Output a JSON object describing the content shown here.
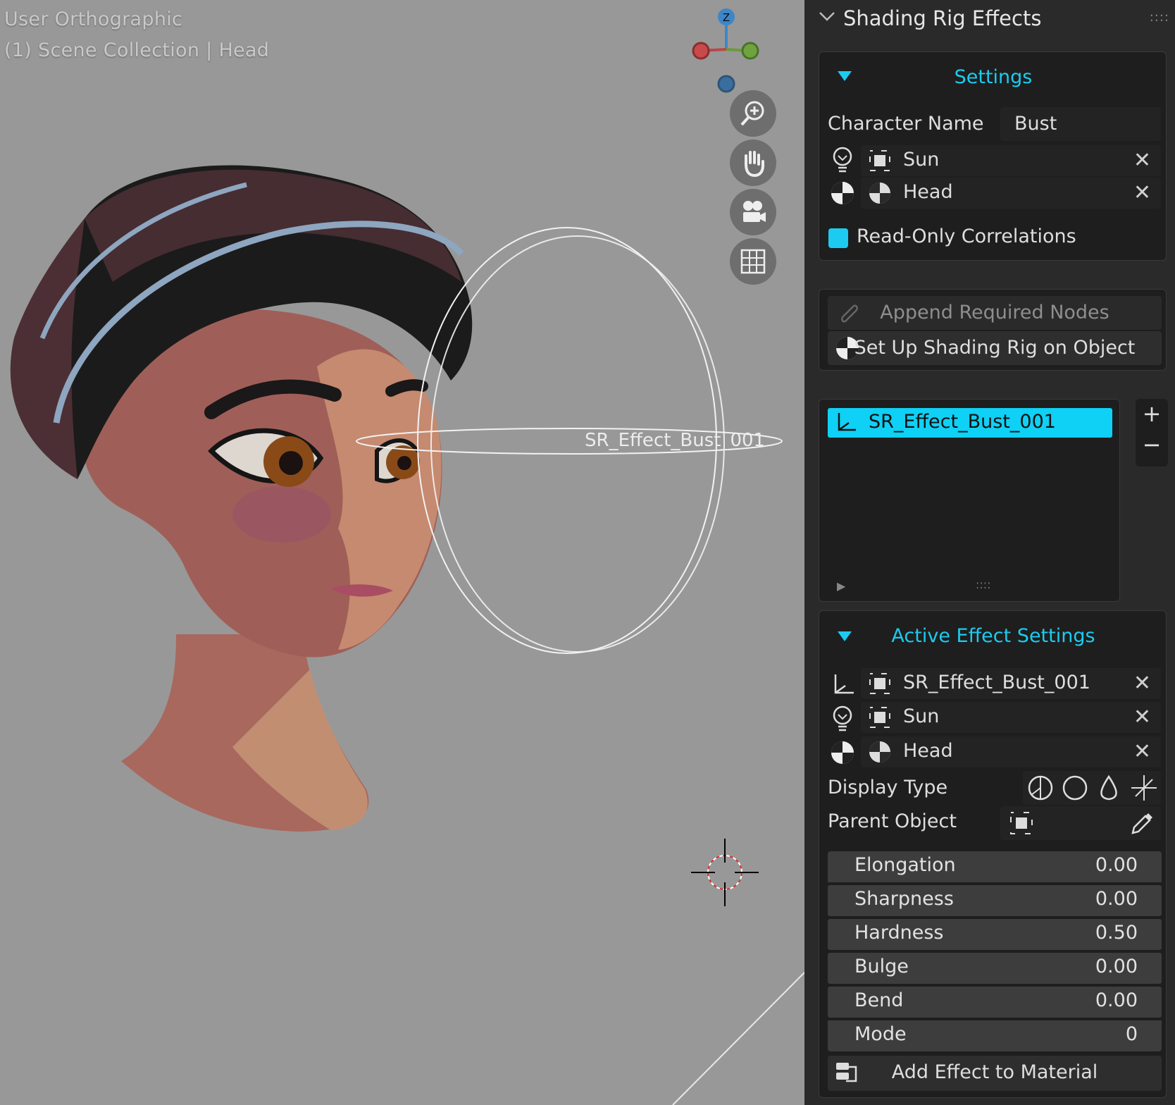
{
  "viewport": {
    "view_name": "User Orthographic",
    "collection_info": "(1) Scene Collection | Head",
    "object_label": "SR_Effect_Bust_001",
    "gizmo_axis": "Z"
  },
  "panel": {
    "title": "Shading Rig Effects",
    "settings": {
      "header": "Settings",
      "character_name_label": "Character Name",
      "character_name_value": "Bust",
      "light_object": "Sun",
      "head_object": "Head",
      "read_only_label": "Read-Only Correlations"
    },
    "actions": {
      "append_nodes": "Append Required Nodes",
      "setup_rig": "Set Up Shading Rig on Object"
    },
    "effects_list": {
      "items": [
        "SR_Effect_Bust_001"
      ],
      "add": "+",
      "remove": "−"
    },
    "active_effect": {
      "header": "Active Effect Settings",
      "effect_object": "SR_Effect_Bust_001",
      "light_object": "Sun",
      "head_object": "Head",
      "display_type_label": "Display Type",
      "parent_object_label": "Parent Object",
      "properties": [
        {
          "label": "Elongation",
          "value": "0.00"
        },
        {
          "label": "Sharpness",
          "value": "0.00"
        },
        {
          "label": "Hardness",
          "value": "0.50"
        },
        {
          "label": "Bulge",
          "value": "0.00"
        },
        {
          "label": "Bend",
          "value": "0.00"
        },
        {
          "label": "Mode",
          "value": "0"
        }
      ],
      "add_to_material": "Add Effect to Material"
    }
  },
  "colors": {
    "accent": "#1ccbef",
    "panel_bg": "#2a2a2a",
    "viewport_bg": "#989898"
  }
}
